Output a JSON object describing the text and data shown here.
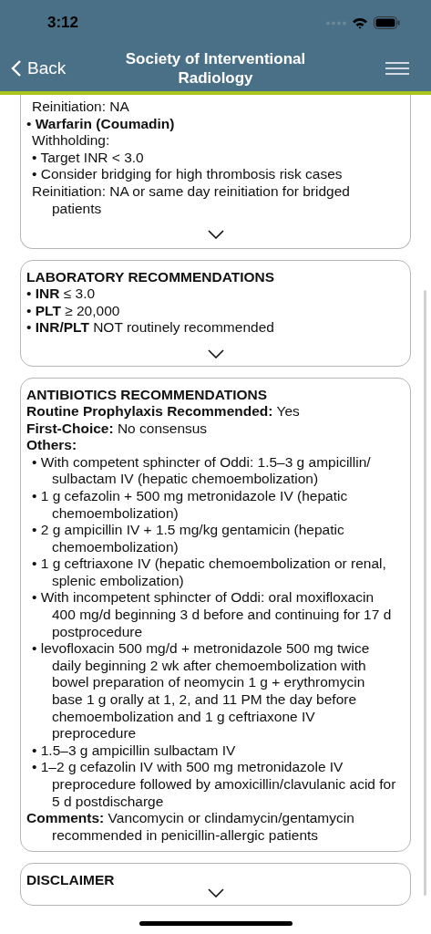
{
  "status_bar": {
    "time": "3:12"
  },
  "nav": {
    "back": "Back",
    "title": "Society of Interventional Radiology"
  },
  "cards": [
    {
      "lines": [
        {
          "kind": "inset",
          "text": "Reinitiation: NA"
        },
        {
          "kind": "plain",
          "text": "• **Warfarin (Coumadin)**"
        },
        {
          "kind": "inset",
          "text": "Withholding:"
        },
        {
          "kind": "inset",
          "text": "• Target INR < 3.0"
        },
        {
          "kind": "inset",
          "text": "• Consider bridging for high thrombosis risk cases"
        },
        {
          "kind": "inset",
          "text": "Reinitiation: NA or same day reinitiation for bridged patients"
        }
      ],
      "collapsible": true
    },
    {
      "title": "LABORATORY RECOMMENDATIONS",
      "lines": [
        {
          "kind": "plain",
          "text": "• **INR** ≤ 3.0"
        },
        {
          "kind": "plain",
          "text": "• **PLT** ≥ 20,000"
        },
        {
          "kind": "plain",
          "text": "• **INR/PLT** NOT routinely recommended"
        }
      ],
      "collapsible": true
    },
    {
      "title": "ANTIBIOTICS RECOMMENDATIONS",
      "lines": [
        {
          "kind": "plain",
          "text": "**Routine Prophylaxis Recommended:** Yes"
        },
        {
          "kind": "plain",
          "text": "**First-Choice:**  No consensus"
        },
        {
          "kind": "plain",
          "text": "**Others:**"
        },
        {
          "kind": "inset",
          "text": "• With competent sphincter of Oddi: 1.5–3 g ampicillin/ sulbactam IV (hepatic chemoembolization)"
        },
        {
          "kind": "inset",
          "text": "• 1 g cefazolin + 500 mg metronidazole IV (hepatic chemoembolization)"
        },
        {
          "kind": "inset",
          "text": "•  2 g ampicillin IV + 1.5 mg/kg gentamicin (hepatic chemoembolization)"
        },
        {
          "kind": "inset",
          "text": "• 1 g ceftriaxone IV (hepatic chemoembolization or renal, splenic embolization)"
        },
        {
          "kind": "inset",
          "text": "• With incompetent sphincter of Oddi: oral moxifloxacin 400 mg/d beginning 3 d before and continuing for 17 d postprocedure"
        },
        {
          "kind": "inset",
          "text": "• levofloxacin 500 mg/d + metronidazole 500 mg twice daily beginning 2 wk after chemoembolization with bowel preparation of neomycin 1 g + erythromycin base 1 g orally at 1, 2, and 11 PM the day before chemoembolization and 1 g ceftriaxone IV preprocedure"
        },
        {
          "kind": "inset",
          "text": "• 1.5–3 g ampicillin sulbactam IV"
        },
        {
          "kind": "inset",
          "text": "•  1–2 g cefazolin IV with 500 mg metronidazole IV preprocedure followed by amoxicillin/clavulanic acid for 5 d postdischarge"
        },
        {
          "kind": "plain",
          "text": "**Comments:**  Vancomycin or clindamycin/gentamycin recommended in penicillin-allergic patients"
        }
      ],
      "collapsible": false
    },
    {
      "title": "DISCLAIMER",
      "collapsible": true
    }
  ]
}
